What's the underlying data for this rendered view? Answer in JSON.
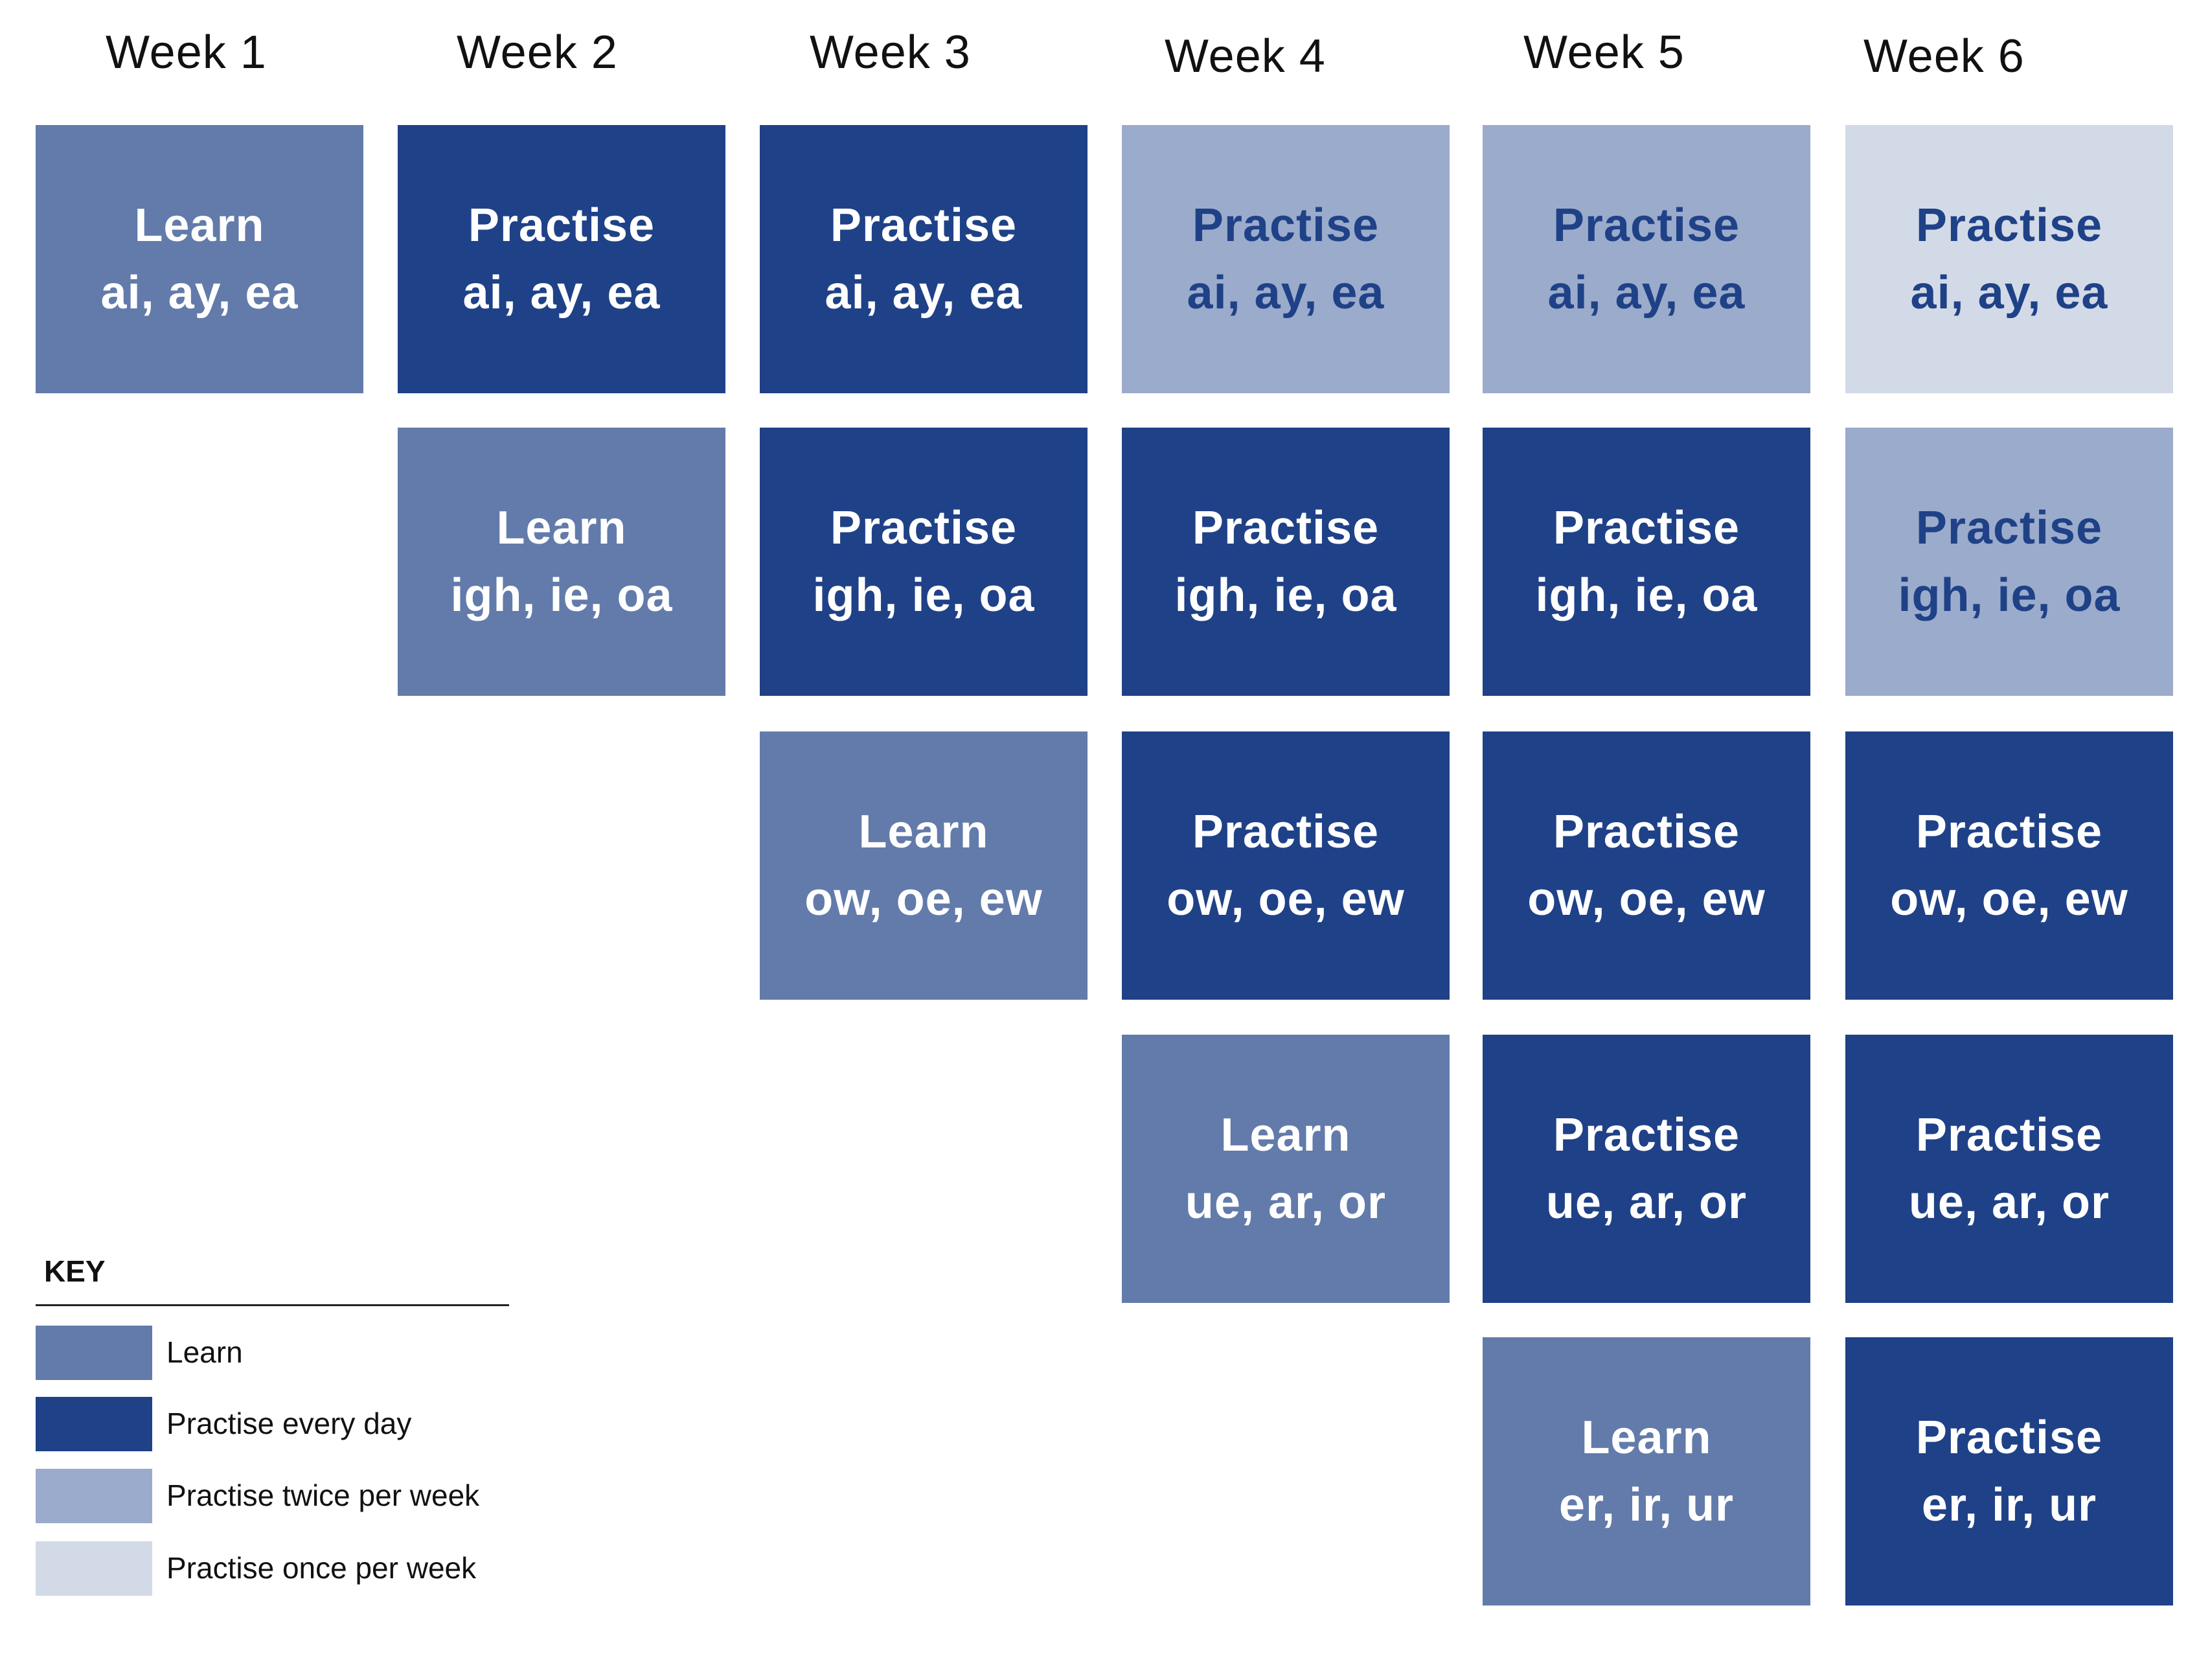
{
  "colors": {
    "learn": "#627BAA",
    "practise_every_day": "#1F4187",
    "practise_twice_per_week": "#9BABCB",
    "practise_once_per_week": "#D3DAE7",
    "text_on_light": "#1F4187",
    "text_on_dark": "#FFFFFF"
  },
  "weeks": [
    "Week 1",
    "Week 2",
    "Week 3",
    "Week 4",
    "Week 5",
    "Week 6"
  ],
  "schedule": [
    {
      "week": 1,
      "row": 1,
      "type": "learn",
      "action": "Learn",
      "sounds": "ai, ay, ea"
    },
    {
      "week": 2,
      "row": 1,
      "type": "daily",
      "action": "Practise",
      "sounds": "ai, ay, ea"
    },
    {
      "week": 2,
      "row": 2,
      "type": "learn",
      "action": "Learn",
      "sounds": "igh, ie, oa"
    },
    {
      "week": 3,
      "row": 1,
      "type": "daily",
      "action": "Practise",
      "sounds": "ai, ay, ea"
    },
    {
      "week": 3,
      "row": 2,
      "type": "daily",
      "action": "Practise",
      "sounds": "igh, ie, oa"
    },
    {
      "week": 3,
      "row": 3,
      "type": "learn",
      "action": "Learn",
      "sounds": "ow, oe, ew"
    },
    {
      "week": 4,
      "row": 1,
      "type": "twice",
      "action": "Practise",
      "sounds": "ai, ay, ea"
    },
    {
      "week": 4,
      "row": 2,
      "type": "daily",
      "action": "Practise",
      "sounds": "igh, ie, oa"
    },
    {
      "week": 4,
      "row": 3,
      "type": "daily",
      "action": "Practise",
      "sounds": "ow, oe, ew"
    },
    {
      "week": 4,
      "row": 4,
      "type": "learn",
      "action": "Learn",
      "sounds": "ue, ar, or"
    },
    {
      "week": 5,
      "row": 1,
      "type": "twice",
      "action": "Practise",
      "sounds": "ai, ay, ea"
    },
    {
      "week": 5,
      "row": 2,
      "type": "daily",
      "action": "Practise",
      "sounds": "igh, ie, oa"
    },
    {
      "week": 5,
      "row": 3,
      "type": "daily",
      "action": "Practise",
      "sounds": "ow, oe, ew"
    },
    {
      "week": 5,
      "row": 4,
      "type": "daily",
      "action": "Practise",
      "sounds": "ue, ar, or"
    },
    {
      "week": 5,
      "row": 5,
      "type": "learn",
      "action": "Learn",
      "sounds": "er, ir, ur"
    },
    {
      "week": 6,
      "row": 1,
      "type": "once",
      "action": "Practise",
      "sounds": "ai, ay, ea"
    },
    {
      "week": 6,
      "row": 2,
      "type": "twice",
      "action": "Practise",
      "sounds": "igh, ie, oa"
    },
    {
      "week": 6,
      "row": 3,
      "type": "daily",
      "action": "Practise",
      "sounds": "ow, oe, ew"
    },
    {
      "week": 6,
      "row": 4,
      "type": "daily",
      "action": "Practise",
      "sounds": "ue, ar, or"
    },
    {
      "week": 6,
      "row": 5,
      "type": "daily",
      "action": "Practise",
      "sounds": "er, ir, ur"
    }
  ],
  "key": {
    "title": "KEY",
    "items": [
      {
        "type": "learn",
        "label": "Learn"
      },
      {
        "type": "daily",
        "label": "Practise every day"
      },
      {
        "type": "twice",
        "label": "Practise twice per week"
      },
      {
        "type": "once",
        "label": "Practise once per week"
      }
    ]
  }
}
